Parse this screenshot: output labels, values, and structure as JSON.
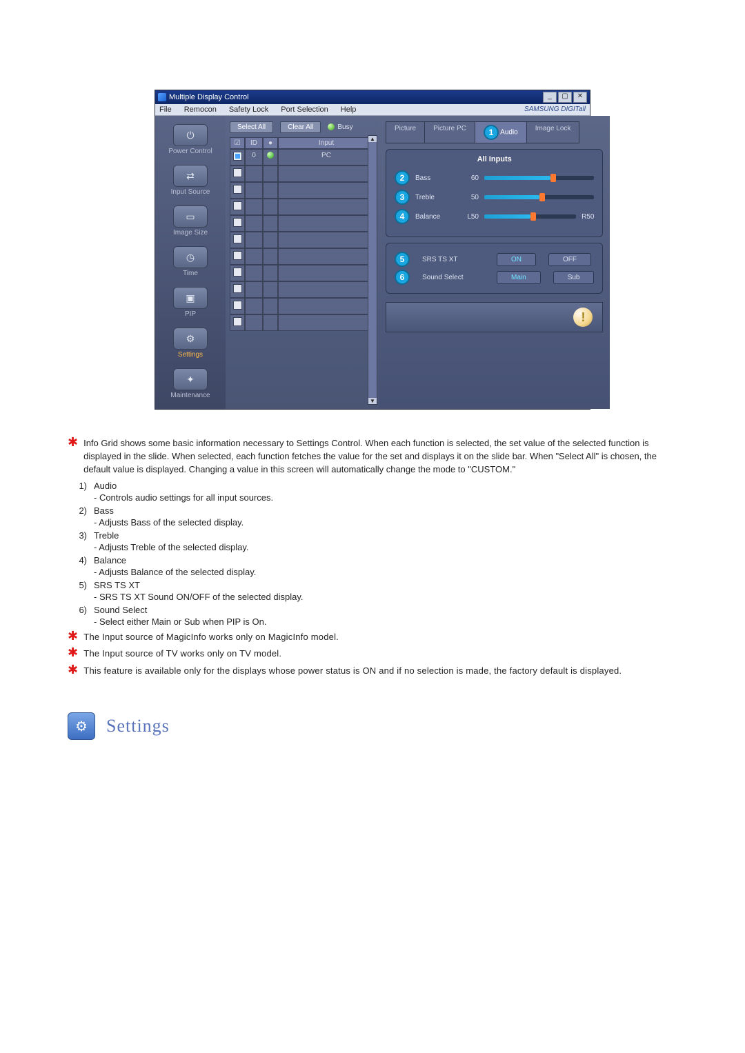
{
  "window": {
    "title": "Multiple Display Control",
    "brand": "SAMSUNG DIGITall"
  },
  "menu": [
    "File",
    "Remocon",
    "Safety Lock",
    "Port Selection",
    "Help"
  ],
  "sidebar": {
    "items": [
      {
        "label": "Power Control",
        "glyph": "⏻"
      },
      {
        "label": "Input Source",
        "glyph": "⇄"
      },
      {
        "label": "Image Size",
        "glyph": "▭"
      },
      {
        "label": "Time",
        "glyph": "◷"
      },
      {
        "label": "PIP",
        "glyph": "▣"
      },
      {
        "label": "Settings",
        "glyph": "⚙"
      },
      {
        "label": "Maintenance",
        "glyph": "✦"
      }
    ]
  },
  "grid": {
    "select_all": "Select All",
    "clear_all": "Clear All",
    "busy": "Busy",
    "headers": {
      "chk": "☑",
      "id": "ID",
      "status": "●",
      "input": "Input"
    },
    "rows": [
      {
        "checked": true,
        "id": "0",
        "status": "on",
        "input": "PC"
      },
      {
        "checked": false,
        "id": "",
        "status": "",
        "input": ""
      },
      {
        "checked": false,
        "id": "",
        "status": "",
        "input": ""
      },
      {
        "checked": false,
        "id": "",
        "status": "",
        "input": ""
      },
      {
        "checked": false,
        "id": "",
        "status": "",
        "input": ""
      },
      {
        "checked": false,
        "id": "",
        "status": "",
        "input": ""
      },
      {
        "checked": false,
        "id": "",
        "status": "",
        "input": ""
      },
      {
        "checked": false,
        "id": "",
        "status": "",
        "input": ""
      },
      {
        "checked": false,
        "id": "",
        "status": "",
        "input": ""
      },
      {
        "checked": false,
        "id": "",
        "status": "",
        "input": ""
      },
      {
        "checked": false,
        "id": "",
        "status": "",
        "input": ""
      }
    ]
  },
  "tabs": {
    "picture": "Picture",
    "picture_pc": "Picture PC",
    "audio": "Audio",
    "image_lock": "Image Lock",
    "callout_audio": "1"
  },
  "audio_panel": {
    "title": "All Inputs",
    "bass": {
      "label": "Bass",
      "value": "60",
      "pct": 60,
      "callout": "2"
    },
    "treble": {
      "label": "Treble",
      "value": "50",
      "pct": 50,
      "callout": "3"
    },
    "balance": {
      "label": "Balance",
      "left": "L50",
      "right": "R50",
      "pct": 50,
      "callout": "4"
    },
    "srs": {
      "label": "SRS TS XT",
      "on": "ON",
      "off": "OFF",
      "callout": "5"
    },
    "sound_select": {
      "label": "Sound Select",
      "main": "Main",
      "sub": "Sub",
      "callout": "6"
    }
  },
  "doc": {
    "intro": "Info Grid shows some basic information necessary to Settings Control. When each function is selected, the set value of the selected function is displayed in the slide. When selected, each function fetches the value for the set and displays it on the slide bar. When \"Select All\" is chosen, the default value is displayed. Changing a value in this screen will automatically change the mode to \"CUSTOM.\"",
    "items": [
      {
        "n": "1)",
        "title": "Audio",
        "desc": "- Controls audio settings for all input sources."
      },
      {
        "n": "2)",
        "title": "Bass",
        "desc": "- Adjusts Bass of the selected display."
      },
      {
        "n": "3)",
        "title": "Treble",
        "desc": "- Adjusts Treble of the selected display."
      },
      {
        "n": "4)",
        "title": "Balance",
        "desc": "- Adjusts Balance of the selected display."
      },
      {
        "n": "5)",
        "title": "SRS TS XT",
        "desc": "- SRS TS XT Sound ON/OFF of the selected display."
      },
      {
        "n": "6)",
        "title": "Sound Select",
        "desc": "- Select either Main or Sub when PIP is On."
      }
    ],
    "notes": [
      "The Input source of MagicInfo works only on MagicInfo model.",
      "The Input source of TV works only on TV model.",
      "This feature is available only for the displays whose power status is ON and if no selection is made, the factory default is displayed."
    ],
    "heading": "Settings"
  }
}
